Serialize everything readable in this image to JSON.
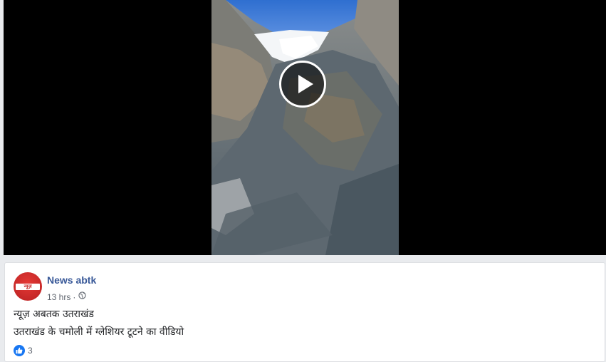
{
  "video": {
    "play_icon": "play-icon",
    "scene": "glacier-mountain"
  },
  "post": {
    "page_name": "News abtk",
    "avatar_text": "न्यूज़",
    "timestamp": "13 hrs",
    "separator": "·",
    "privacy_icon": "globe-icon",
    "line1": "न्यूज़ अबतक उतराखंड",
    "line2": "उतराखंड के चमोली में ग्लेशियर टूटने का वीडियो",
    "reactions": {
      "icon": "like-icon",
      "count": "3",
      "color": "#1877f2"
    }
  },
  "colors": {
    "page_name": "#385898",
    "background": "#e9ebee"
  }
}
